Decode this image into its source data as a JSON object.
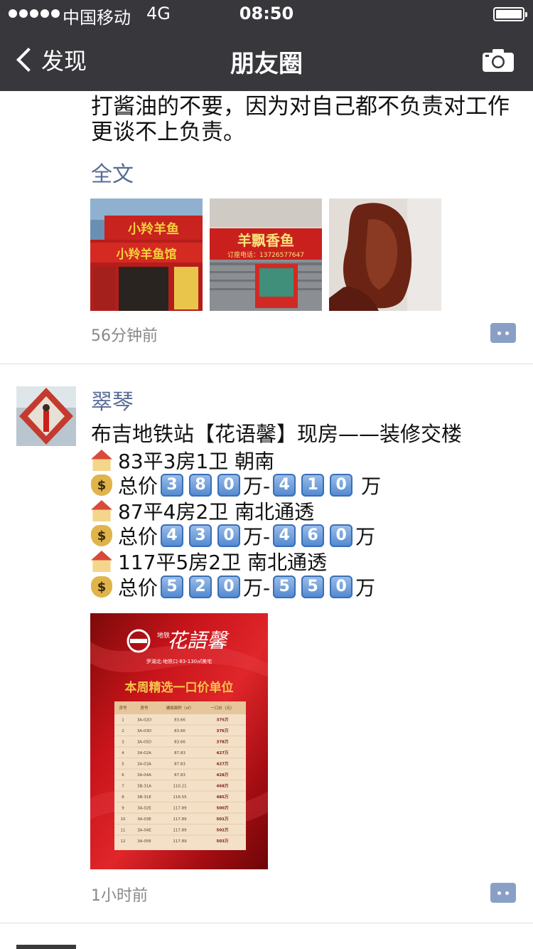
{
  "status_bar": {
    "carrier": "中国移动",
    "network": "4G",
    "time": "08:50"
  },
  "nav": {
    "back_label": "发现",
    "title": "朋友圈"
  },
  "post1": {
    "text_lines": [
      "打酱油的不要，因为对自己都不负责对工作",
      "更谈不上负责。"
    ],
    "full_text_link": "全文",
    "images": [
      {
        "signs": [
          "小羚羊鱼",
          "小羚羊鱼馆"
        ]
      },
      {
        "signs": [
          "羊飘香鱼",
          "订座电话：13726577647"
        ]
      },
      {
        "signs": []
      }
    ],
    "time": "56分钟前"
  },
  "post2": {
    "name": "翠琴",
    "headline": "布吉地铁站【花语馨】现房——装修交楼",
    "items": [
      {
        "icon": "house-icon",
        "text": "83平3房1卫 朝南"
      },
      {
        "icon": "money-bag-icon",
        "label": "总价",
        "digits1": [
          "3",
          "8",
          "0"
        ],
        "sep": "万-",
        "digits2": [
          "4",
          "1",
          "0"
        ],
        "unit": "万"
      },
      {
        "icon": "house-icon",
        "text": "87平4房2卫 南北通透"
      },
      {
        "icon": "money-bag-icon",
        "label": "总价",
        "digits1": [
          "4",
          "3",
          "0"
        ],
        "sep": "万-",
        "digits2": [
          "4",
          "6",
          "0"
        ],
        "unit": "万"
      },
      {
        "icon": "house-icon",
        "text": "117平5房2卫 南北通透"
      },
      {
        "icon": "money-bag-icon",
        "label": "总价",
        "digits1": [
          "5",
          "2",
          "0"
        ],
        "sep": "万-",
        "digits2": [
          "5",
          "5",
          "0"
        ],
        "unit": "万"
      }
    ],
    "poster": {
      "brand": "花語馨",
      "brand_prefix": "地铁",
      "subtitle": "罗湖北·地铁口·83-130㎡美宅",
      "heading": "本周精选一口价单位",
      "table_headers": [
        "序号",
        "房号",
        "建筑面积（㎡）",
        "一口价（元）"
      ],
      "table_rows": [
        [
          "1",
          "3A-02D",
          "83.66",
          "375万"
        ],
        [
          "2",
          "3A-03D",
          "83.66",
          "376万"
        ],
        [
          "3",
          "3A-05D",
          "83.66",
          "378万"
        ],
        [
          "4",
          "3A-02A",
          "87.83",
          "427万"
        ],
        [
          "5",
          "3A-03A",
          "87.83",
          "427万"
        ],
        [
          "6",
          "3A-04A",
          "87.83",
          "428万"
        ],
        [
          "7",
          "3B-31A",
          "110.21",
          "468万"
        ],
        [
          "8",
          "3B-31E",
          "116.55",
          "485万"
        ],
        [
          "9",
          "3A-02E",
          "117.89",
          "500万"
        ],
        [
          "10",
          "3A-03E",
          "117.89",
          "501万"
        ],
        [
          "11",
          "3A-04E",
          "117.89",
          "502万"
        ],
        [
          "12",
          "3A-05E",
          "117.89",
          "503万"
        ]
      ]
    },
    "time": "1小时前"
  }
}
